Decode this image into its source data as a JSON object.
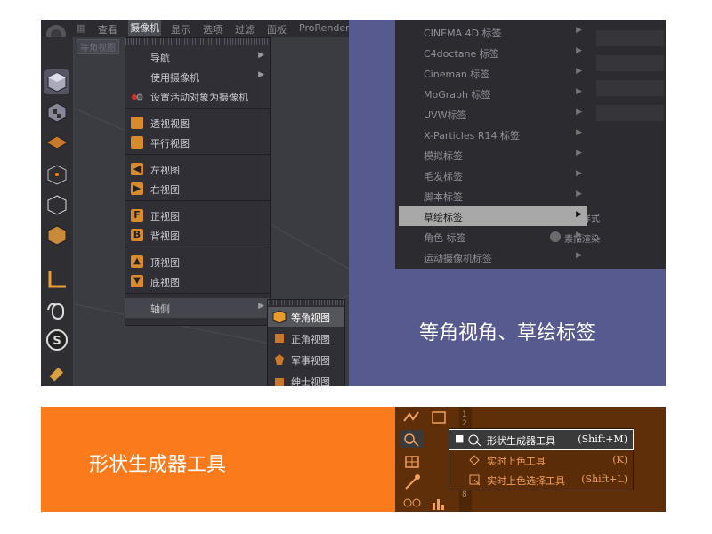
{
  "c4d": {
    "topbar": {
      "items": [
        "查看",
        "摄像机",
        "显示",
        "选项",
        "过滤",
        "面板",
        "ProRender"
      ],
      "active_index": 1
    },
    "view_label": "等角视图",
    "camera_menu": {
      "items": [
        {
          "label": "导航",
          "submenu": true
        },
        {
          "label": "使用摄像机",
          "submenu": true
        },
        {
          "label": "设置活动对象为摄像机",
          "icon": "camera-target-icon"
        },
        {
          "label": "透视视图",
          "icon": "cube-orange-icon"
        },
        {
          "label": "平行视图",
          "icon": "cube-orange-icon"
        },
        {
          "label": "左视图",
          "icon": "arrow-left-icon"
        },
        {
          "label": "右视图",
          "icon": "arrow-right-icon"
        },
        {
          "label": "正视图",
          "icon": "letter-f-icon"
        },
        {
          "label": "背视图",
          "icon": "letter-b-icon"
        },
        {
          "label": "顶视图",
          "icon": "arrow-up-icon"
        },
        {
          "label": "底视图",
          "icon": "arrow-down-icon"
        },
        {
          "label": "轴侧",
          "submenu": true
        }
      ]
    },
    "axis_submenu": {
      "items": [
        {
          "label": "等角视图",
          "highlighted": true
        },
        {
          "label": "正角视图"
        },
        {
          "label": "军事视图"
        },
        {
          "label": "绅士视图"
        }
      ]
    }
  },
  "tags_panel": {
    "menu_items": [
      "CINEMA 4D 标签",
      "C4doctane 标签",
      "Cineman 标签",
      "MoGraph 标签",
      "UVW标签",
      "X-Particles R14 标签",
      "模拟标签",
      "毛发标签",
      "脚本标签",
      "草绘标签",
      "角色 标签",
      "运动摄像机标签"
    ],
    "highlighted_index": 9,
    "submenu_items": [
      "素描样式",
      "素描渲染"
    ],
    "caption": "等角视角、草绘标签"
  },
  "orange_banner": {
    "caption": "形状生成器工具"
  },
  "ai_panel": {
    "ruler_digits": [
      "1",
      "2",
      "8"
    ],
    "flyout": [
      {
        "label": "形状生成器工具",
        "shortcut": "(Shift+M)",
        "selected": true
      },
      {
        "label": "实时上色工具",
        "shortcut": "(K)"
      },
      {
        "label": "实时上色选择工具",
        "shortcut": "(Shift+L)"
      }
    ]
  },
  "colors": {
    "purple_panel": "#575a8e",
    "orange_banner": "#fb7a1c",
    "brown_panel": "#5e2f08",
    "c4d_dark": "#2f2f35"
  }
}
